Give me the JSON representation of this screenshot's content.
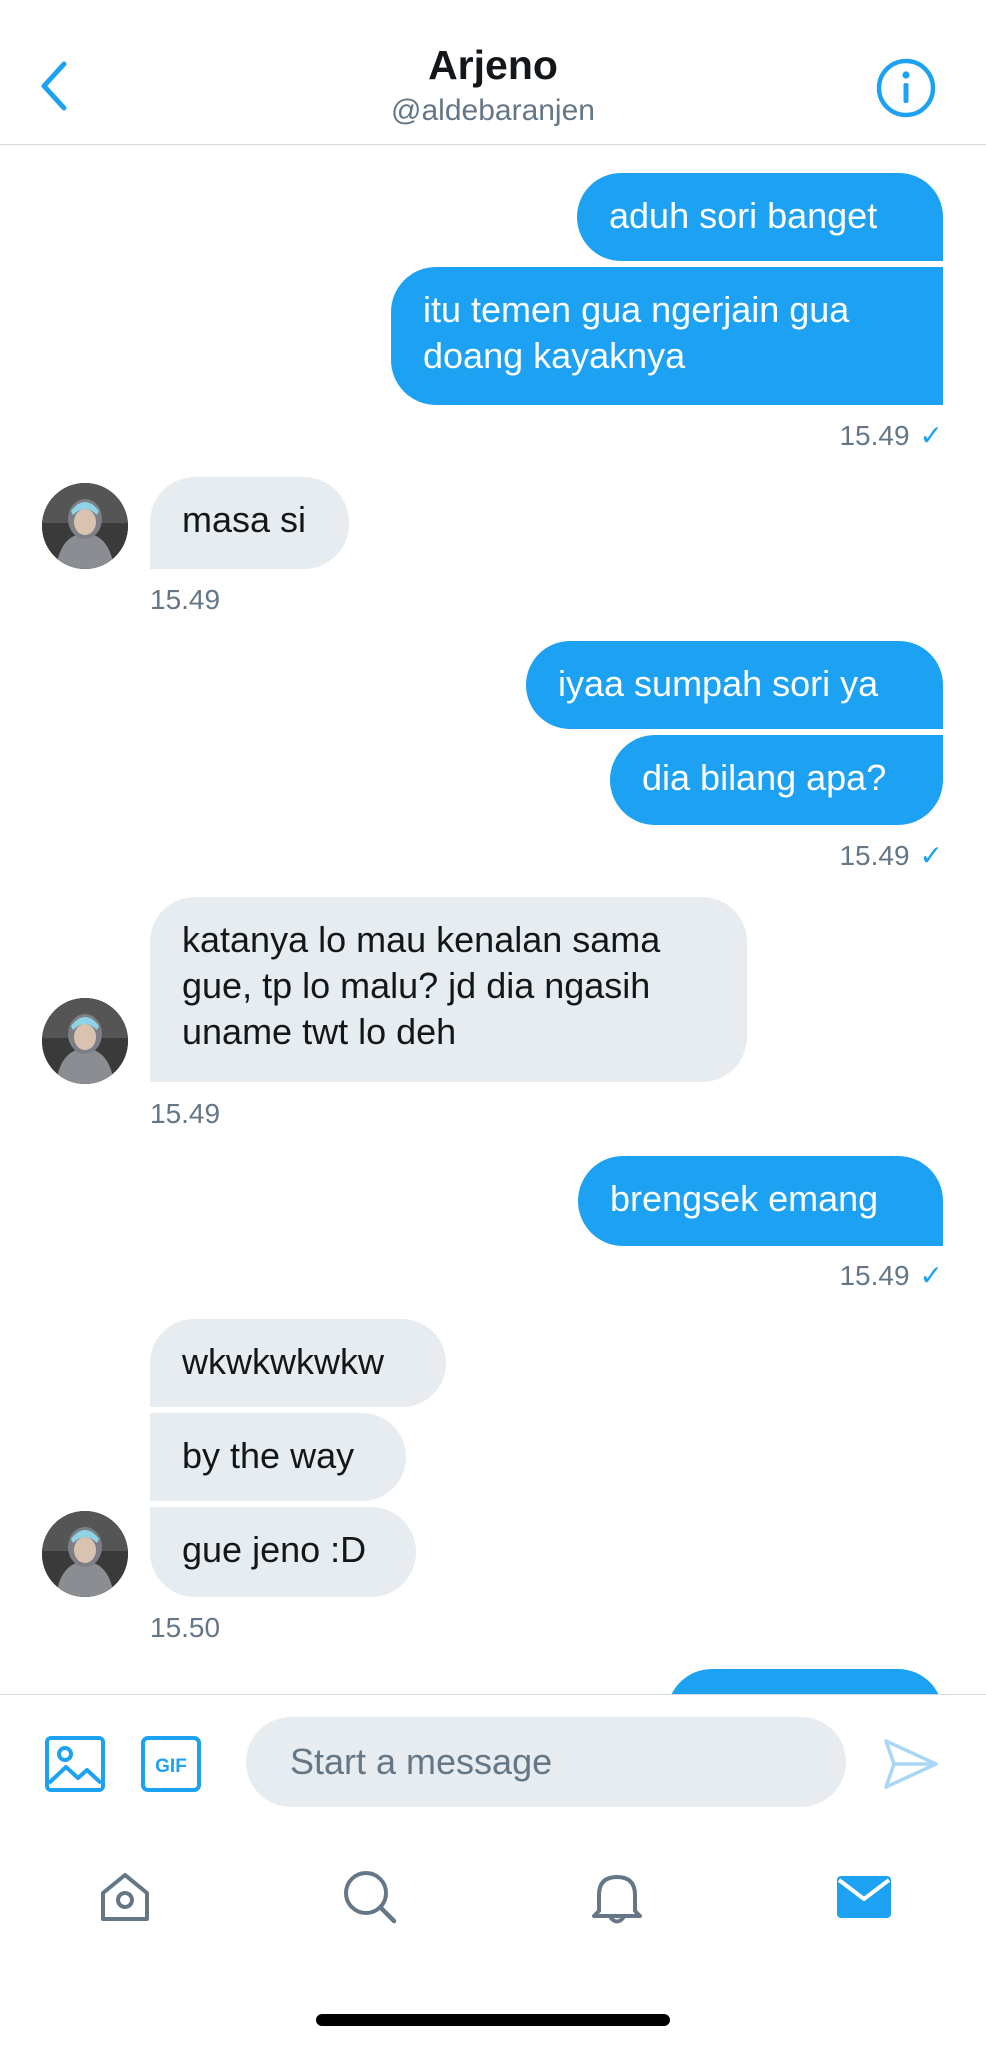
{
  "header": {
    "title": "Arjeno",
    "handle": "@aldebaranjen"
  },
  "messages": {
    "m1": "aduh sori banget",
    "m2_line1": "itu temen gua ngerjain gua",
    "m2_line2": "doang kayaknya",
    "t1": "15.49",
    "m3": "masa si",
    "t2": "15.49",
    "m4": "iyaa sumpah sori ya",
    "m5": "dia bilang apa?",
    "t3": "15.49",
    "m6_line1": "katanya lo mau kenalan sama",
    "m6_line2": "gue, tp lo malu? jd dia ngasih",
    "m6_line3": "uname twt lo deh",
    "t4": "15.49",
    "m7": "brengsek emang",
    "t5": "15.49",
    "m8": "wkwkwkwkw",
    "m9": "by the way",
    "m10": "gue jeno :D",
    "t6": "15.50"
  },
  "composer": {
    "placeholder": "Start a message",
    "gif_label": "GIF"
  },
  "icons": {
    "back": "chevron-left-icon",
    "info": "info-icon",
    "media": "image-icon",
    "gif": "gif-icon",
    "send": "send-icon",
    "home": "home-icon",
    "search": "search-icon",
    "notifications": "bell-icon",
    "messages": "mail-icon"
  },
  "colors": {
    "accent": "#1da1f2",
    "received_bubble": "#e6ecf0",
    "secondary_text": "#657786"
  }
}
